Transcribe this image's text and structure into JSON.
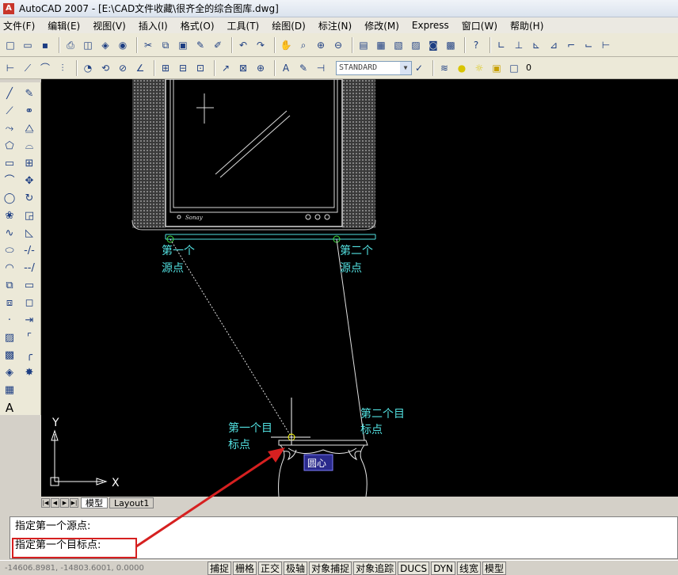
{
  "window": {
    "title": "AutoCAD 2007 - [E:\\CAD文件收藏\\很齐全的综合图库.dwg]",
    "app_icon": "A"
  },
  "menu": [
    "文件(F)",
    "编辑(E)",
    "视图(V)",
    "插入(I)",
    "格式(O)",
    "工具(T)",
    "绘图(D)",
    "标注(N)",
    "修改(M)",
    "Express",
    "窗口(W)",
    "帮助(H)"
  ],
  "toolbar2": {
    "text_style": "STANDARD",
    "layer": "0"
  },
  "drawing": {
    "tv_brand": "Sonay",
    "labels": {
      "src1": [
        "第一个",
        "源点"
      ],
      "src2": [
        "第二个",
        "源点"
      ],
      "dst1": [
        "第一个目",
        "标点"
      ],
      "dst2": [
        "第二个目",
        "标点"
      ]
    },
    "snap_tooltip": "圆心",
    "ucs": {
      "y": "Y",
      "x": "X"
    }
  },
  "tabs": {
    "model": "模型",
    "layout1": "Layout1"
  },
  "command": {
    "line1": "指定第一个源点:",
    "line2": "指定第一个目标点:"
  },
  "status": {
    "coords": "-14606.8981, -14803.6001, 0.0000",
    "buttons": [
      "捕捉",
      "栅格",
      "正交",
      "极轴",
      "对象捕捉",
      "对象追踪",
      "DUCS",
      "DYN",
      "线宽",
      "模型"
    ]
  },
  "colors": {
    "cyan": "#52e0e0",
    "annot": "#d62020",
    "tooltip_bg": "#2a2a8c"
  }
}
